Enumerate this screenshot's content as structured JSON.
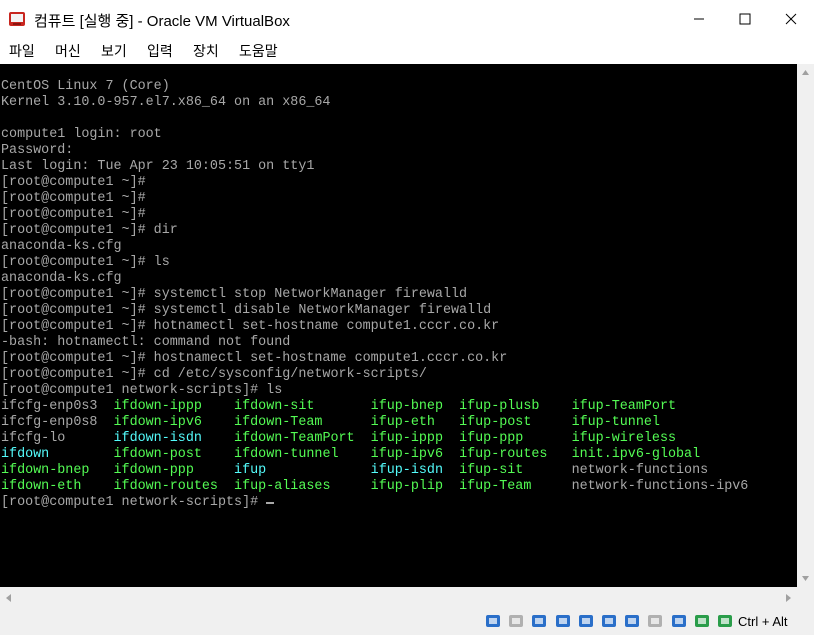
{
  "window": {
    "title": "컴퓨트 [실행 중] - Oracle VM VirtualBox"
  },
  "menu": [
    {
      "label": "파일"
    },
    {
      "label": "머신"
    },
    {
      "label": "보기"
    },
    {
      "label": "입력"
    },
    {
      "label": "장치"
    },
    {
      "label": "도움말"
    }
  ],
  "terminal": {
    "lines": [
      {
        "text": "CentOS Linux 7 (Core)"
      },
      {
        "text": "Kernel 3.10.0-957.el7.x86_64 on an x86_64"
      },
      {
        "text": ""
      },
      {
        "text": "compute1 login: root"
      },
      {
        "text": "Password:"
      },
      {
        "text": "Last login: Tue Apr 23 10:05:51 on tty1"
      },
      {
        "text": "[root@compute1 ~]#"
      },
      {
        "text": "[root@compute1 ~]#"
      },
      {
        "text": "[root@compute1 ~]#"
      },
      {
        "text": "[root@compute1 ~]# dir"
      },
      {
        "text": "anaconda-ks.cfg"
      },
      {
        "text": "[root@compute1 ~]# ls"
      },
      {
        "text": "anaconda-ks.cfg"
      },
      {
        "text": "[root@compute1 ~]# systemctl stop NetworkManager firewalld"
      },
      {
        "text": "[root@compute1 ~]# systemctl disable NetworkManager firewalld"
      },
      {
        "text": "[root@compute1 ~]# hotnamectl set-hostname compute1.cccr.co.kr"
      },
      {
        "text": "-bash: hotnamectl: command not found"
      },
      {
        "text": "[root@compute1 ~]# hostnamectl set-hostname compute1.cccr.co.kr"
      },
      {
        "text": "[root@compute1 ~]# cd /etc/sysconfig/network-scripts/"
      },
      {
        "text": "[root@compute1 network-scripts]# ls"
      }
    ],
    "ls_rows": [
      [
        {
          "text": "ifcfg-enp0s3  ",
          "color": "white"
        },
        {
          "text": "ifdown-ippp    ",
          "color": "green"
        },
        {
          "text": "ifdown-sit       ",
          "color": "green"
        },
        {
          "text": "ifup-bnep  ",
          "color": "green"
        },
        {
          "text": "ifup-plusb    ",
          "color": "green"
        },
        {
          "text": "ifup-TeamPort",
          "color": "green"
        }
      ],
      [
        {
          "text": "ifcfg-enp0s8  ",
          "color": "white"
        },
        {
          "text": "ifdown-ipv6    ",
          "color": "green"
        },
        {
          "text": "ifdown-Team      ",
          "color": "green"
        },
        {
          "text": "ifup-eth   ",
          "color": "green"
        },
        {
          "text": "ifup-post     ",
          "color": "green"
        },
        {
          "text": "ifup-tunnel",
          "color": "green"
        }
      ],
      [
        {
          "text": "ifcfg-lo      ",
          "color": "white"
        },
        {
          "text": "ifdown-isdn    ",
          "color": "cyan"
        },
        {
          "text": "ifdown-TeamPort  ",
          "color": "green"
        },
        {
          "text": "ifup-ippp  ",
          "color": "green"
        },
        {
          "text": "ifup-ppp      ",
          "color": "green"
        },
        {
          "text": "ifup-wireless",
          "color": "green"
        }
      ],
      [
        {
          "text": "ifdown        ",
          "color": "cyan"
        },
        {
          "text": "ifdown-post    ",
          "color": "green"
        },
        {
          "text": "ifdown-tunnel    ",
          "color": "green"
        },
        {
          "text": "ifup-ipv6  ",
          "color": "green"
        },
        {
          "text": "ifup-routes   ",
          "color": "green"
        },
        {
          "text": "init.ipv6-global",
          "color": "green"
        }
      ],
      [
        {
          "text": "ifdown-bnep   ",
          "color": "green"
        },
        {
          "text": "ifdown-ppp     ",
          "color": "green"
        },
        {
          "text": "ifup             ",
          "color": "cyan"
        },
        {
          "text": "ifup-isdn  ",
          "color": "cyan"
        },
        {
          "text": "ifup-sit      ",
          "color": "green"
        },
        {
          "text": "network-functions",
          "color": "white"
        }
      ],
      [
        {
          "text": "ifdown-eth    ",
          "color": "green"
        },
        {
          "text": "ifdown-routes  ",
          "color": "green"
        },
        {
          "text": "ifup-aliases     ",
          "color": "green"
        },
        {
          "text": "ifup-plip  ",
          "color": "green"
        },
        {
          "text": "ifup-Team     ",
          "color": "green"
        },
        {
          "text": "network-functions-ipv6",
          "color": "white"
        }
      ]
    ],
    "prompt": "[root@compute1 network-scripts]# "
  },
  "status": {
    "icons": [
      {
        "name": "hard-disk-icon",
        "color": "#2a6fc9"
      },
      {
        "name": "optical-drive-icon",
        "color": "#b0b0b0"
      },
      {
        "name": "audio-icon",
        "color": "#2a6fc9"
      },
      {
        "name": "network-icon",
        "color": "#2a6fc9"
      },
      {
        "name": "usb-icon",
        "color": "#2a6fc9"
      },
      {
        "name": "shared-folders-icon",
        "color": "#2a6fc9"
      },
      {
        "name": "display-icon",
        "color": "#2a6fc9"
      },
      {
        "name": "video-capture-icon",
        "color": "#b0b0b0"
      },
      {
        "name": "virtualization-icon",
        "color": "#2a6fc9"
      },
      {
        "name": "mouse-integration-icon",
        "color": "#2a9d4a"
      },
      {
        "name": "keyboard-capture-icon",
        "color": "#2a9d4a"
      }
    ],
    "host_key": "Ctrl + Alt"
  },
  "colors": {
    "terminal_bg": "#000000",
    "terminal_fg": "#a8a8a8",
    "ls_green": "#54fc54",
    "ls_cyan": "#54fcfc"
  }
}
